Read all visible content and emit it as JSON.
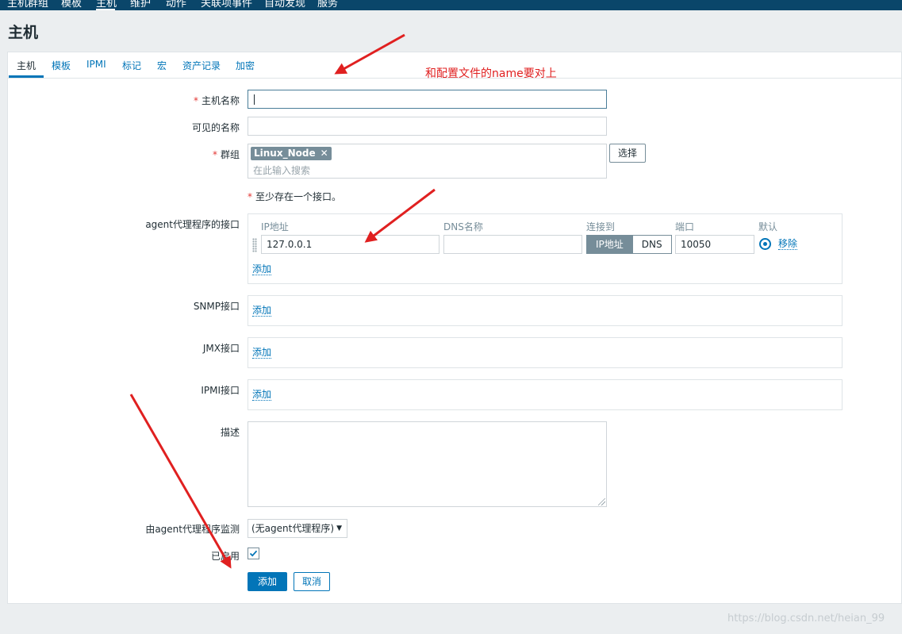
{
  "top_nav": {
    "items": [
      "主机群组",
      "模板",
      "主机",
      "维护",
      "动作",
      "关联项事件",
      "自动发现",
      "服务"
    ],
    "active": "主机"
  },
  "page": {
    "title": "主机"
  },
  "tabs": [
    {
      "label": "主机",
      "active": true
    },
    {
      "label": "模板"
    },
    {
      "label": "IPMI"
    },
    {
      "label": "标记"
    },
    {
      "label": "宏"
    },
    {
      "label": "资产记录"
    },
    {
      "label": "加密"
    }
  ],
  "form": {
    "required_mark": "*",
    "host_name": {
      "label": "主机名称",
      "value": ""
    },
    "visible_name": {
      "label": "可见的名称",
      "value": ""
    },
    "groups": {
      "label": "群组",
      "chips": [
        "Linux_Node"
      ],
      "placeholder": "在此输入搜索",
      "select_label": "选择",
      "remove_glyph": "✕"
    },
    "interface_hint": "至少存在一个接口。",
    "agent_interfaces": {
      "label": "agent代理程序的接口",
      "columns": [
        "IP地址",
        "DNS名称",
        "连接到",
        "端口",
        "默认"
      ],
      "row": {
        "ip": "127.0.0.1",
        "dns": "",
        "connect_ip": "IP地址",
        "connect_dns": "DNS",
        "port": "10050",
        "default_selected": true,
        "remove": "移除"
      },
      "add": "添加"
    },
    "snmp_interfaces": {
      "label": "SNMP接口",
      "add": "添加"
    },
    "jmx_interfaces": {
      "label": "JMX接口",
      "add": "添加"
    },
    "ipmi_interfaces": {
      "label": "IPMI接口",
      "add": "添加"
    },
    "description": {
      "label": "描述",
      "value": ""
    },
    "monitored_by": {
      "label": "由agent代理程序监测",
      "selected": "(无agent代理程序)"
    },
    "enabled": {
      "label": "已启用",
      "checked": true
    },
    "buttons": {
      "add": "添加",
      "cancel": "取消"
    }
  },
  "annotation": {
    "text": "和配置文件的name要对上",
    "color": "#e02020"
  },
  "watermark": "https://blog.csdn.net/heian_99",
  "colors": {
    "nav": "#0a466a",
    "link": "#0275b8",
    "required": "#e33734",
    "chip": "#768d99",
    "arrow": "#e02020"
  }
}
